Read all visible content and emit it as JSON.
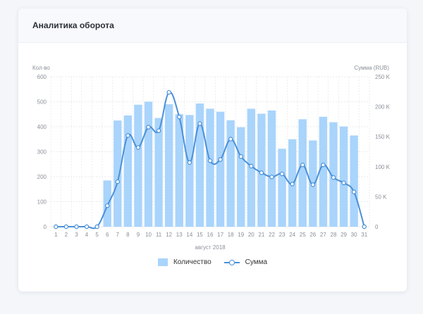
{
  "card": {
    "title": "Аналитика оборота"
  },
  "colors": {
    "bar": "#a9d4fb",
    "line": "#4a90d9",
    "grid": "#dfe3e8",
    "text": "#8a8f98"
  },
  "chart_data": {
    "type": "bar",
    "categories": [
      "1",
      "2",
      "3",
      "4",
      "5",
      "6",
      "7",
      "8",
      "9",
      "10",
      "11",
      "12",
      "13",
      "14",
      "15",
      "16",
      "17",
      "18",
      "19",
      "20",
      "21",
      "22",
      "23",
      "24",
      "25",
      "26",
      "27",
      "28",
      "29",
      "30",
      "31"
    ],
    "series": [
      {
        "name": "Количество",
        "type": "bar",
        "axis": "left",
        "values": [
          0,
          0,
          0,
          0,
          0,
          185,
          425,
          445,
          488,
          500,
          435,
          490,
          450,
          447,
          493,
          472,
          460,
          426,
          398,
          472,
          452,
          465,
          312,
          350,
          430,
          345,
          440,
          418,
          401,
          365,
          0
        ]
      },
      {
        "name": "Сумма",
        "type": "line",
        "axis": "right",
        "values": [
          0,
          0,
          0,
          0,
          0,
          35000,
          75000,
          152000,
          132000,
          166000,
          160000,
          224000,
          183000,
          107000,
          172000,
          110000,
          112000,
          146000,
          117000,
          101000,
          90000,
          83000,
          88000,
          71000,
          103000,
          70000,
          103000,
          82000,
          73000,
          58000,
          0
        ]
      }
    ],
    "xlabel": "август 2018",
    "ylabel_left": "Кол-во",
    "ylabel_right": "Сумма (RUB)",
    "ylim_left": [
      0,
      600
    ],
    "ylim_right": [
      0,
      250000
    ],
    "yticks_left": [
      "0",
      "100",
      "200",
      "300",
      "400",
      "500",
      "600"
    ],
    "yticks_right": [
      "0",
      "50 K",
      "100 K",
      "150 K",
      "200 K",
      "250 K"
    ],
    "grid": true,
    "legend_position": "bottom"
  },
  "legend": {
    "bars_label": "Количество",
    "line_label": "Сумма"
  }
}
